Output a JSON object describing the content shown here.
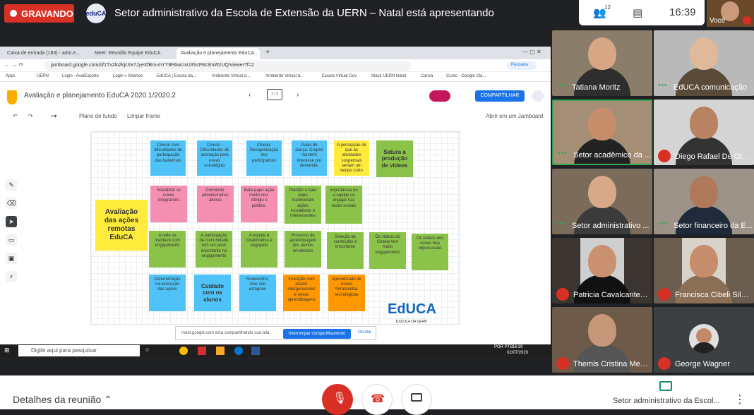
{
  "top": {
    "recording_label": "GRAVANDO",
    "org_logo": "eduCA",
    "presenting_text": "Setor administrativo da Escola de Extensão da UERN – Natal está apresentando",
    "participants_count": "12",
    "clock": "16:39",
    "self_label": "Você"
  },
  "browser": {
    "tabs": [
      "Caixa de entrada (183) - adm.e...",
      "Meet: Reunião Equipe EduCA",
      "Avaliação e planejamento EduCA..."
    ],
    "url": "jamboard.google.com/d/1Tx2lo2kjcXe7JyeXfBm-mYY8PAwUxU3ScF8c3mWzUQ/viewer?f=2",
    "bookmarks": [
      "Apps",
      "UERN",
      "Login - AvaiEsporte",
      "Login » Alliance",
      "EdUCA | Escola da...",
      "Ambiente Virtual d...",
      "Ambiente Virtual d...",
      "Escola Virtual Gov",
      "Slack UERN Natal",
      "Canva",
      "Curso - Google Cla..."
    ],
    "profile_label": "Pausada"
  },
  "jamboard": {
    "title": "Avaliação e planejamento EduCA 2020.1/2020.2",
    "frame_indicator": "1 / 2",
    "share_label": "COMPARTILHAR",
    "tools": {
      "background": "Plano de fundo",
      "clear": "Limpar frame",
      "open": "Abrir em um Jamboard"
    },
    "main_note": "Avaliação das ações remotas EduCA",
    "notes": [
      "Cinese com dificuldades de participação das bailarinas",
      "Cinese - Dificuldades de aceitação para novas estratégias",
      "Cinese: Reorganização dos participantes",
      "Aulas de dança. Grupos mantem interesse por demanda.",
      "A percepção de que as atividades suspensas seriam um tempo curto",
      "Satura a produção de vídeos",
      "Socializar os novos integrantes",
      "Dormindo: administrativo: alteras",
      "Bate-papo ação muito rico. Atingiu o público.",
      "Plantão e bate papo mantiveram ações inovadoras e interessantes",
      "Importância de a equipe se engajar nas redes sociais",
      "A rede se manteve com engajamento",
      "A participação da comunidade tem um peso importante no engajamento",
      "A equipe é colaborativa e engajada",
      "Processo de aprendizagem dos alunos envolvidos",
      "Seleção de conteúdos é importante",
      "Os vídeos do Cinese tem muito engajamento",
      "Os vídeos dos corais boa repercussão",
      "Determinação na execução das ações",
      "Cuidado com os alunos",
      "Redesenho, mas não estagnou",
      "Inovação com prazer intergeracional e novas aprendizagens",
      "Aprendizado de novas ferramentas tecnológicas"
    ],
    "logo_text": "EdUCA",
    "logo_sub": "ESCOLA DA UERN"
  },
  "share_bar": {
    "text": "meet.google.com está compartilhando sua tela.",
    "stop": "Interromper compartilhamento",
    "hide": "Ocultar"
  },
  "taskbar": {
    "search": "Digite aqui para pesquisar",
    "lang": "POR PTB",
    "time": "16:39",
    "date": "02/07/2020"
  },
  "participants": [
    {
      "name": "Tatiana Moritz",
      "muted": false
    },
    {
      "name": "EdUCA comunicação",
      "muted": false
    },
    {
      "name": "Setor acadêmico da ...",
      "muted": false
    },
    {
      "name": "Diego Rafael De Oliv...",
      "muted": true
    },
    {
      "name": "Setor administrativo ...",
      "muted": false
    },
    {
      "name": "Setor financeiro da E...",
      "muted": false
    },
    {
      "name": "Patricia Cavalcante d...",
      "muted": true
    },
    {
      "name": "Francisca Cibeli Silva...",
      "muted": true
    },
    {
      "name": "Themis Cristina Mes...",
      "muted": true
    },
    {
      "name": "George Wagner",
      "muted": true
    }
  ],
  "bottom": {
    "details": "Detalhes da reunião",
    "presenting": "Setor administrativo da Escol..."
  },
  "colors": {
    "record": "#d93025",
    "accent": "#1a73e8",
    "active": "#34a853"
  }
}
